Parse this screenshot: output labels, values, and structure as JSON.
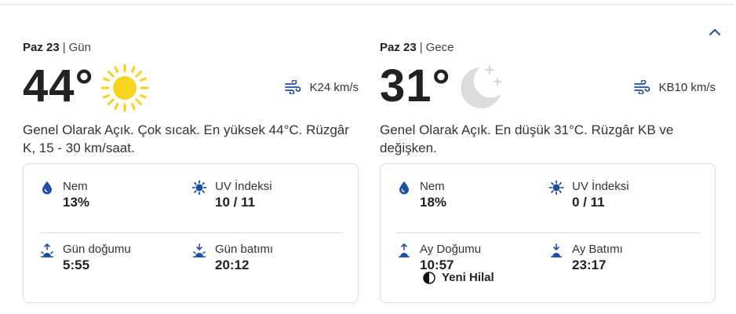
{
  "day": {
    "date_name": "Paz 23",
    "period": "Gün",
    "temperature": "44°",
    "icon": "sun-icon",
    "wind": "K24 km/s",
    "description": "Genel Olarak Açık. Çok sıcak. En yüksek 44°C. Rüzgâr K, 15 - 30 km/saat.",
    "details": {
      "humidity_label": "Nem",
      "humidity_value": "13%",
      "uv_label": "UV İndeksi",
      "uv_value": "10 / 11",
      "rise_label": "Gün doğumu",
      "rise_value": "5:55",
      "set_label": "Gün batımı",
      "set_value": "20:12"
    }
  },
  "night": {
    "date_name": "Paz 23",
    "period": "Gece",
    "temperature": "31°",
    "icon": "moon-stars-icon",
    "wind": "KB10 km/s",
    "description": "Genel Olarak Açık. En düşük 31°C. Rüzgâr KB ve değişken.",
    "details": {
      "humidity_label": "Nem",
      "humidity_value": "18%",
      "uv_label": "UV İndeksi",
      "uv_value": "0 / 11",
      "rise_label": "Ay Doğumu",
      "rise_value": "10:57",
      "set_label": "Ay Batımı",
      "set_value": "23:17",
      "moon_phase": "Yeni Hilal"
    }
  },
  "colors": {
    "accent": "#1f4fa3",
    "sun": "#f7d21e",
    "moon": "#dcdcdc",
    "text": "#222222",
    "border": "#dcdcdc"
  }
}
